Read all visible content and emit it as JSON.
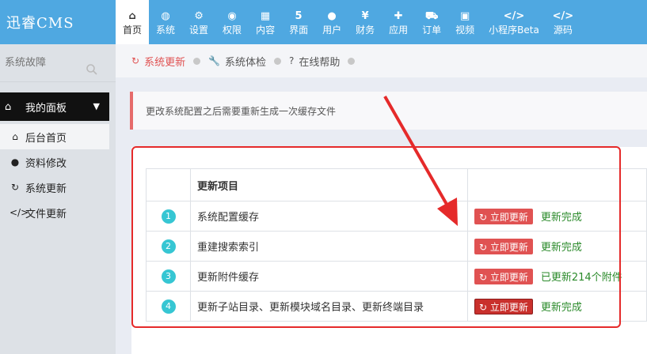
{
  "app": {
    "logo": "迅睿CMS"
  },
  "nav": [
    {
      "label": "首页",
      "icon": "home-icon",
      "glyph": "⌂",
      "active": true
    },
    {
      "label": "系统",
      "icon": "globe-icon",
      "glyph": "◍"
    },
    {
      "label": "设置",
      "icon": "cogs-icon",
      "glyph": "⚙"
    },
    {
      "label": "权限",
      "icon": "user-circle-icon",
      "glyph": "◉"
    },
    {
      "label": "内容",
      "icon": "grid-icon",
      "glyph": "▦"
    },
    {
      "label": "界面",
      "icon": "html5-icon",
      "glyph": "5"
    },
    {
      "label": "用户",
      "icon": "user-icon",
      "glyph": "●"
    },
    {
      "label": "财务",
      "icon": "yen-icon",
      "glyph": "¥"
    },
    {
      "label": "应用",
      "icon": "puzzle-icon",
      "glyph": "✚"
    },
    {
      "label": "订单",
      "icon": "cart-icon",
      "glyph": "⛟"
    },
    {
      "label": "视频",
      "icon": "video-icon",
      "glyph": "▣"
    },
    {
      "label": "小程序Beta",
      "icon": "code-icon",
      "glyph": "</>"
    },
    {
      "label": "源码",
      "icon": "code-icon",
      "glyph": "</>"
    }
  ],
  "sidebar": {
    "search_placeholder": "系统故障",
    "section_label": "我的面板",
    "items": [
      {
        "label": "后台首页",
        "glyph": "⌂",
        "icon": "home-icon"
      },
      {
        "label": "资料修改",
        "glyph": "●",
        "icon": "user-icon"
      },
      {
        "label": "系统更新",
        "glyph": "↻",
        "icon": "refresh-icon"
      },
      {
        "label": "文件更新",
        "glyph": "</>",
        "icon": "code-icon"
      }
    ]
  },
  "tabs": [
    {
      "label": "系统更新",
      "glyph": "↻",
      "icon": "refresh-icon",
      "active": true
    },
    {
      "label": "系统体检",
      "glyph": "🔧",
      "icon": "wrench-icon"
    },
    {
      "label": "在线帮助",
      "glyph": "?",
      "icon": "question-icon"
    }
  ],
  "notice": "更改系统配置之后需要重新生成一次缓存文件",
  "table": {
    "header": "更新项目",
    "button_label": "立即更新",
    "rows": [
      {
        "num": "1",
        "item": "系统配置缓存",
        "status": "更新完成"
      },
      {
        "num": "2",
        "item": "重建搜索索引",
        "status": "更新完成"
      },
      {
        "num": "3",
        "item": "更新附件缓存",
        "status": "已更新214个附件"
      },
      {
        "num": "4",
        "item": "更新子站目录、更新模块域名目录、更新终端目录",
        "status": "更新完成"
      }
    ]
  },
  "colors": {
    "topbar": "#4fa8e1",
    "accent_red": "#e05252",
    "success": "#2a8a2a",
    "badge": "#36c6d3"
  }
}
